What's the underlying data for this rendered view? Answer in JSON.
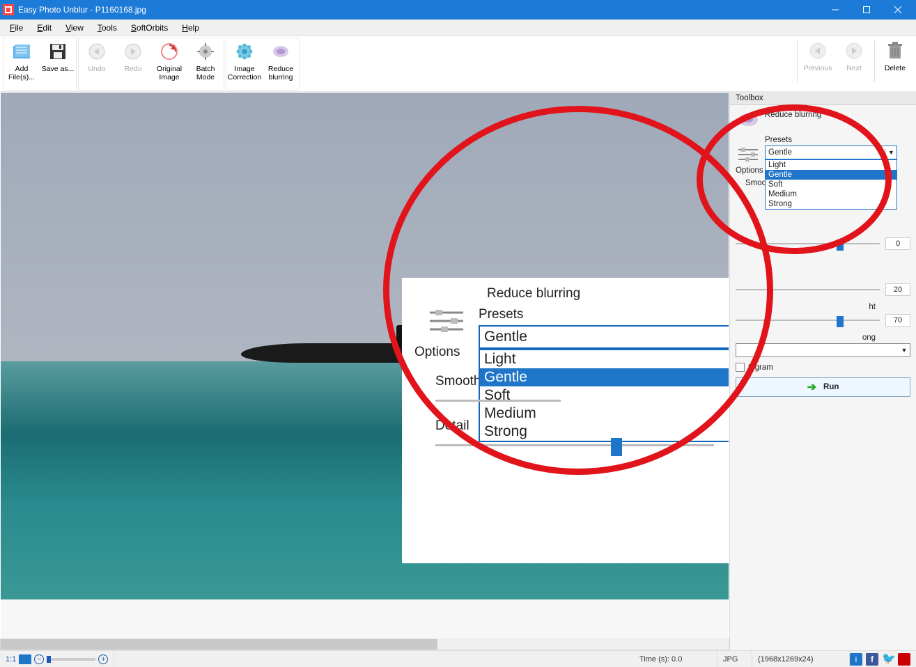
{
  "titlebar": {
    "title": "Easy Photo Unblur - P1160168.jpg"
  },
  "menu": {
    "file": "File",
    "edit": "Edit",
    "view": "View",
    "tools": "Tools",
    "softorbits": "SoftOrbits",
    "help": "Help"
  },
  "toolbar": {
    "add_files": "Add File(s)...",
    "save_as": "Save as...",
    "undo": "Undo",
    "redo": "Redo",
    "original_image": "Original Image",
    "batch_mode": "Batch Mode",
    "image_correction": "Image Correction",
    "reduce_blurring": "Reduce blurring",
    "previous": "Previous",
    "next": "Next",
    "delete": "Delete"
  },
  "sidebar": {
    "toolbox": "Toolbox",
    "section_title": "Reduce blurring",
    "presets_label": "Presets",
    "preset_selected": "Gentle",
    "preset_options": [
      "Light",
      "Gentle",
      "Soft",
      "Medium",
      "Strong"
    ],
    "options_label": "Options",
    "smoothing_label": "Smoothing",
    "detail_label": "Detail",
    "detail_percent": 70,
    "param_a_value": "20",
    "param_b_value": "70",
    "param_b_label_frag": "ht",
    "param_c_label_frag": "ong",
    "histogram_label_frag": "togram",
    "run": "Run"
  },
  "zoom": {
    "title": "Reduce blurring",
    "presets_label": "Presets",
    "preset_selected": "Gentle",
    "preset_options": [
      "Light",
      "Gentle",
      "Soft",
      "Medium",
      "Strong"
    ],
    "options_label": "Options",
    "smoothing_label": "Smoothi",
    "detail_label": "Detail",
    "detail_percent": 63
  },
  "status": {
    "ratio": "1:1",
    "time": "Time (s): 0.0",
    "format": "JPG",
    "dimensions": "(1968x1269x24)"
  }
}
